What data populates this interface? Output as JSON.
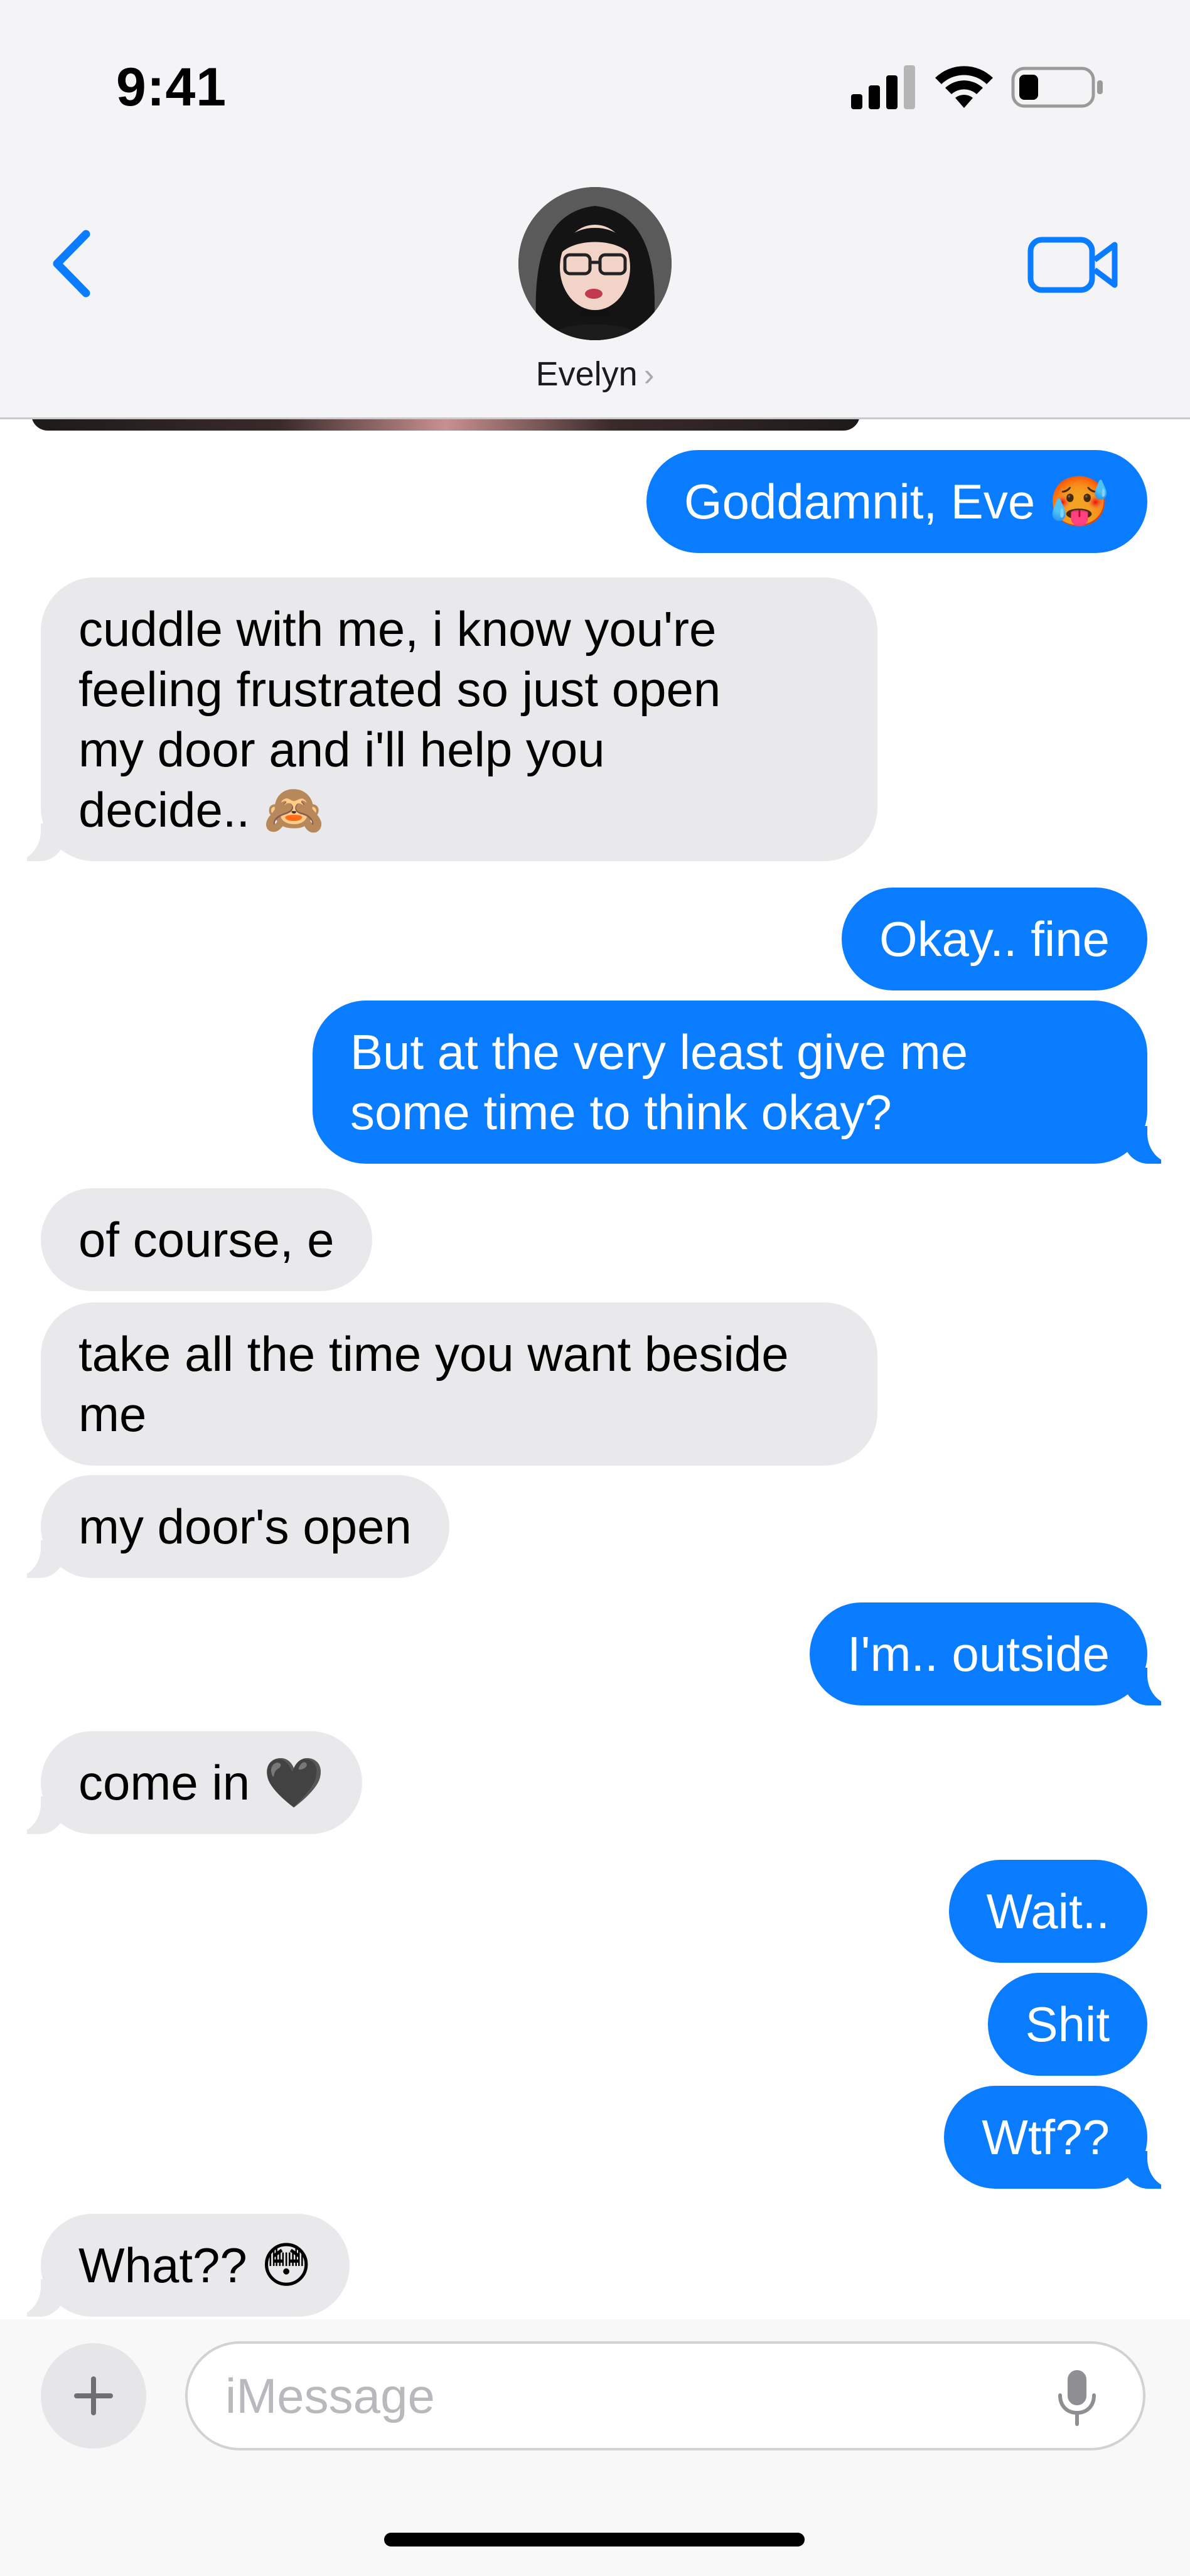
{
  "status_bar": {
    "time": "9:41"
  },
  "header": {
    "contact_name": "Evelyn",
    "chevron": "›"
  },
  "messages": [
    {
      "from": "me",
      "text": "Goddamnit, Eve 🥵"
    },
    {
      "from": "contact",
      "text": "cuddle with me, i know you're\nfeeling frustrated so just open\nmy door and i'll help you\ndecide.. 🙈"
    },
    {
      "from": "me",
      "text": "Okay.. fine"
    },
    {
      "from": "me",
      "text": "But at the very least give me\nsome time to think okay?"
    },
    {
      "from": "contact",
      "text": "of course, e"
    },
    {
      "from": "contact",
      "text": "take all the time you want beside\nme"
    },
    {
      "from": "contact",
      "text": "my door's open"
    },
    {
      "from": "me",
      "text": "I'm.. outside"
    },
    {
      "from": "contact",
      "text": "come in 🖤"
    },
    {
      "from": "me",
      "text": "Wait.."
    },
    {
      "from": "me",
      "text": "Shit"
    },
    {
      "from": "me",
      "text": "Wtf??"
    },
    {
      "from": "contact",
      "text": "What?? 😳"
    }
  ],
  "composer": {
    "placeholder": "iMessage"
  },
  "colors": {
    "outgoing_bubble": "#0a7cff",
    "incoming_bubble": "#e9e9eb",
    "accent": "#0a7cff"
  },
  "icons": [
    "back-chevron-icon",
    "facetime-video-icon",
    "plus-icon",
    "microphone-icon",
    "cellular-signal-icon",
    "wifi-icon",
    "battery-icon"
  ]
}
